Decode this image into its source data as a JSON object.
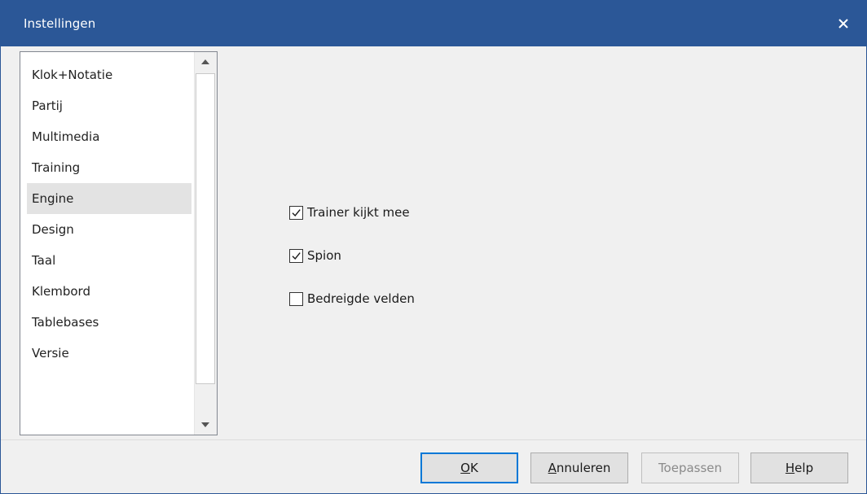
{
  "window": {
    "title": "Instellingen",
    "accent_color": "#2b5797",
    "close_icon": "close-icon"
  },
  "categories": {
    "items": [
      {
        "label": "Klok+Notatie",
        "selected": false
      },
      {
        "label": "Partij",
        "selected": false
      },
      {
        "label": "Multimedia",
        "selected": false
      },
      {
        "label": "Training",
        "selected": false
      },
      {
        "label": "Engine",
        "selected": true
      },
      {
        "label": "Design",
        "selected": false
      },
      {
        "label": "Taal",
        "selected": false
      },
      {
        "label": "Klembord",
        "selected": false
      },
      {
        "label": "Tablebases",
        "selected": false
      },
      {
        "label": "Versie",
        "selected": false
      }
    ],
    "scroll_up_icon": "triangle-up-icon",
    "scroll_down_icon": "triangle-down-icon"
  },
  "options": [
    {
      "label": "Trainer kijkt mee",
      "checked": true
    },
    {
      "label": "Spion",
      "checked": true
    },
    {
      "label": "Bedreigde velden",
      "checked": false
    }
  ],
  "buttons": {
    "ok": {
      "mnemonic": "O",
      "rest": "K"
    },
    "cancel": {
      "mnemonic": "A",
      "rest": "nnuleren"
    },
    "apply": {
      "label": "Toepassen",
      "enabled": false
    },
    "help": {
      "mnemonic": "H",
      "rest": "elp"
    }
  }
}
